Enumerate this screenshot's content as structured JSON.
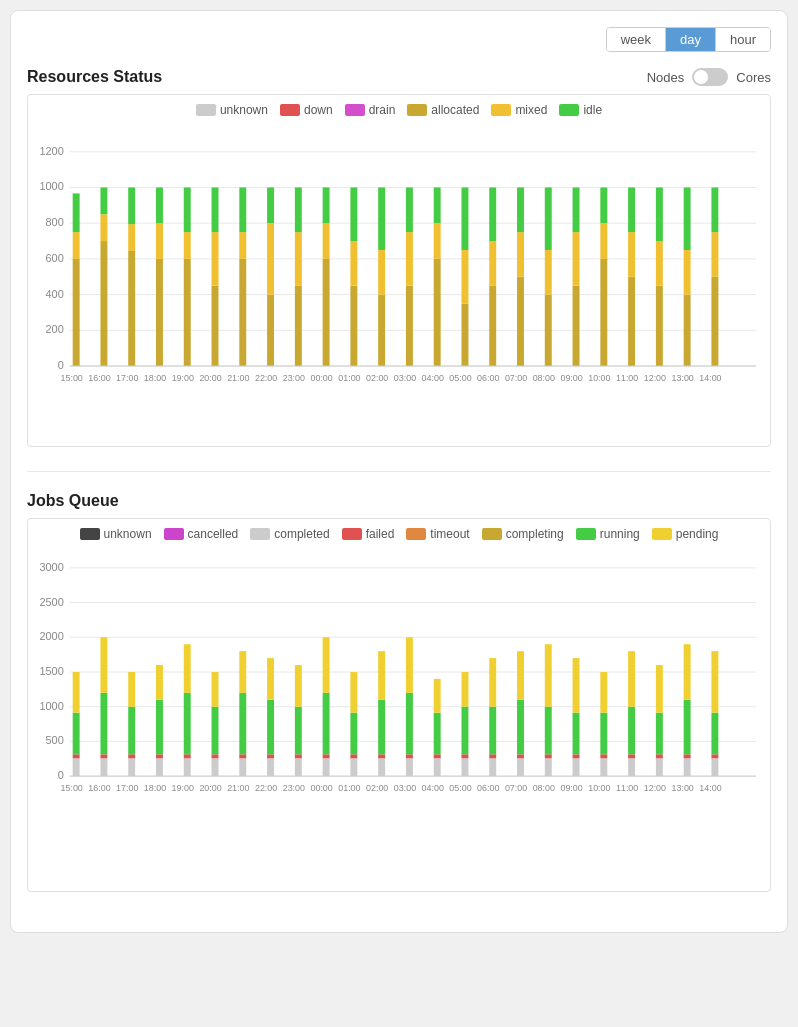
{
  "toolbar": {
    "buttons": [
      {
        "label": "week",
        "active": false
      },
      {
        "label": "day",
        "active": true
      },
      {
        "label": "hour",
        "active": false
      }
    ]
  },
  "resources": {
    "title": "Resources Status",
    "toggle": {
      "left_label": "Nodes",
      "right_label": "Cores"
    },
    "legend": [
      {
        "label": "unknown",
        "color": "#cccccc"
      },
      {
        "label": "down",
        "color": "#e05252"
      },
      {
        "label": "drain",
        "color": "#d44fcc"
      },
      {
        "label": "allocated",
        "color": "#c8a830"
      },
      {
        "label": "mixed",
        "color": "#f0c030"
      },
      {
        "label": "idle",
        "color": "#44cc44"
      }
    ],
    "yaxis": [
      "1200",
      "1000",
      "800",
      "600",
      "400",
      "200",
      "0"
    ],
    "xaxis": [
      "15:00",
      "16:00",
      "17:00",
      "18:00",
      "19:00",
      "20:00",
      "21:00",
      "22:00",
      "23:00",
      "00:00",
      "01:00",
      "02:00",
      "03:00",
      "04:00",
      "05:00",
      "06:00",
      "07:00",
      "08:00",
      "09:00",
      "10:00",
      "11:00",
      "12:00",
      "13:00",
      "14:00"
    ]
  },
  "jobs": {
    "title": "Jobs Queue",
    "legend": [
      {
        "label": "unknown",
        "color": "#444444"
      },
      {
        "label": "cancelled",
        "color": "#cc44cc"
      },
      {
        "label": "completed",
        "color": "#cccccc"
      },
      {
        "label": "failed",
        "color": "#e05252"
      },
      {
        "label": "timeout",
        "color": "#e08840"
      },
      {
        "label": "completing",
        "color": "#c8a830"
      },
      {
        "label": "running",
        "color": "#44cc44"
      },
      {
        "label": "pending",
        "color": "#f0d030"
      }
    ],
    "yaxis": [
      "3000",
      "2500",
      "2000",
      "1500",
      "1000",
      "500",
      "0"
    ],
    "xaxis": [
      "15:00",
      "16:00",
      "17:00",
      "18:00",
      "19:00",
      "20:00",
      "21:00",
      "22:00",
      "23:00",
      "00:00",
      "01:00",
      "02:00",
      "03:00",
      "04:00",
      "05:00",
      "06:00",
      "07:00",
      "08:00",
      "09:00",
      "10:00",
      "11:00",
      "12:00",
      "13:00",
      "14:00"
    ]
  }
}
